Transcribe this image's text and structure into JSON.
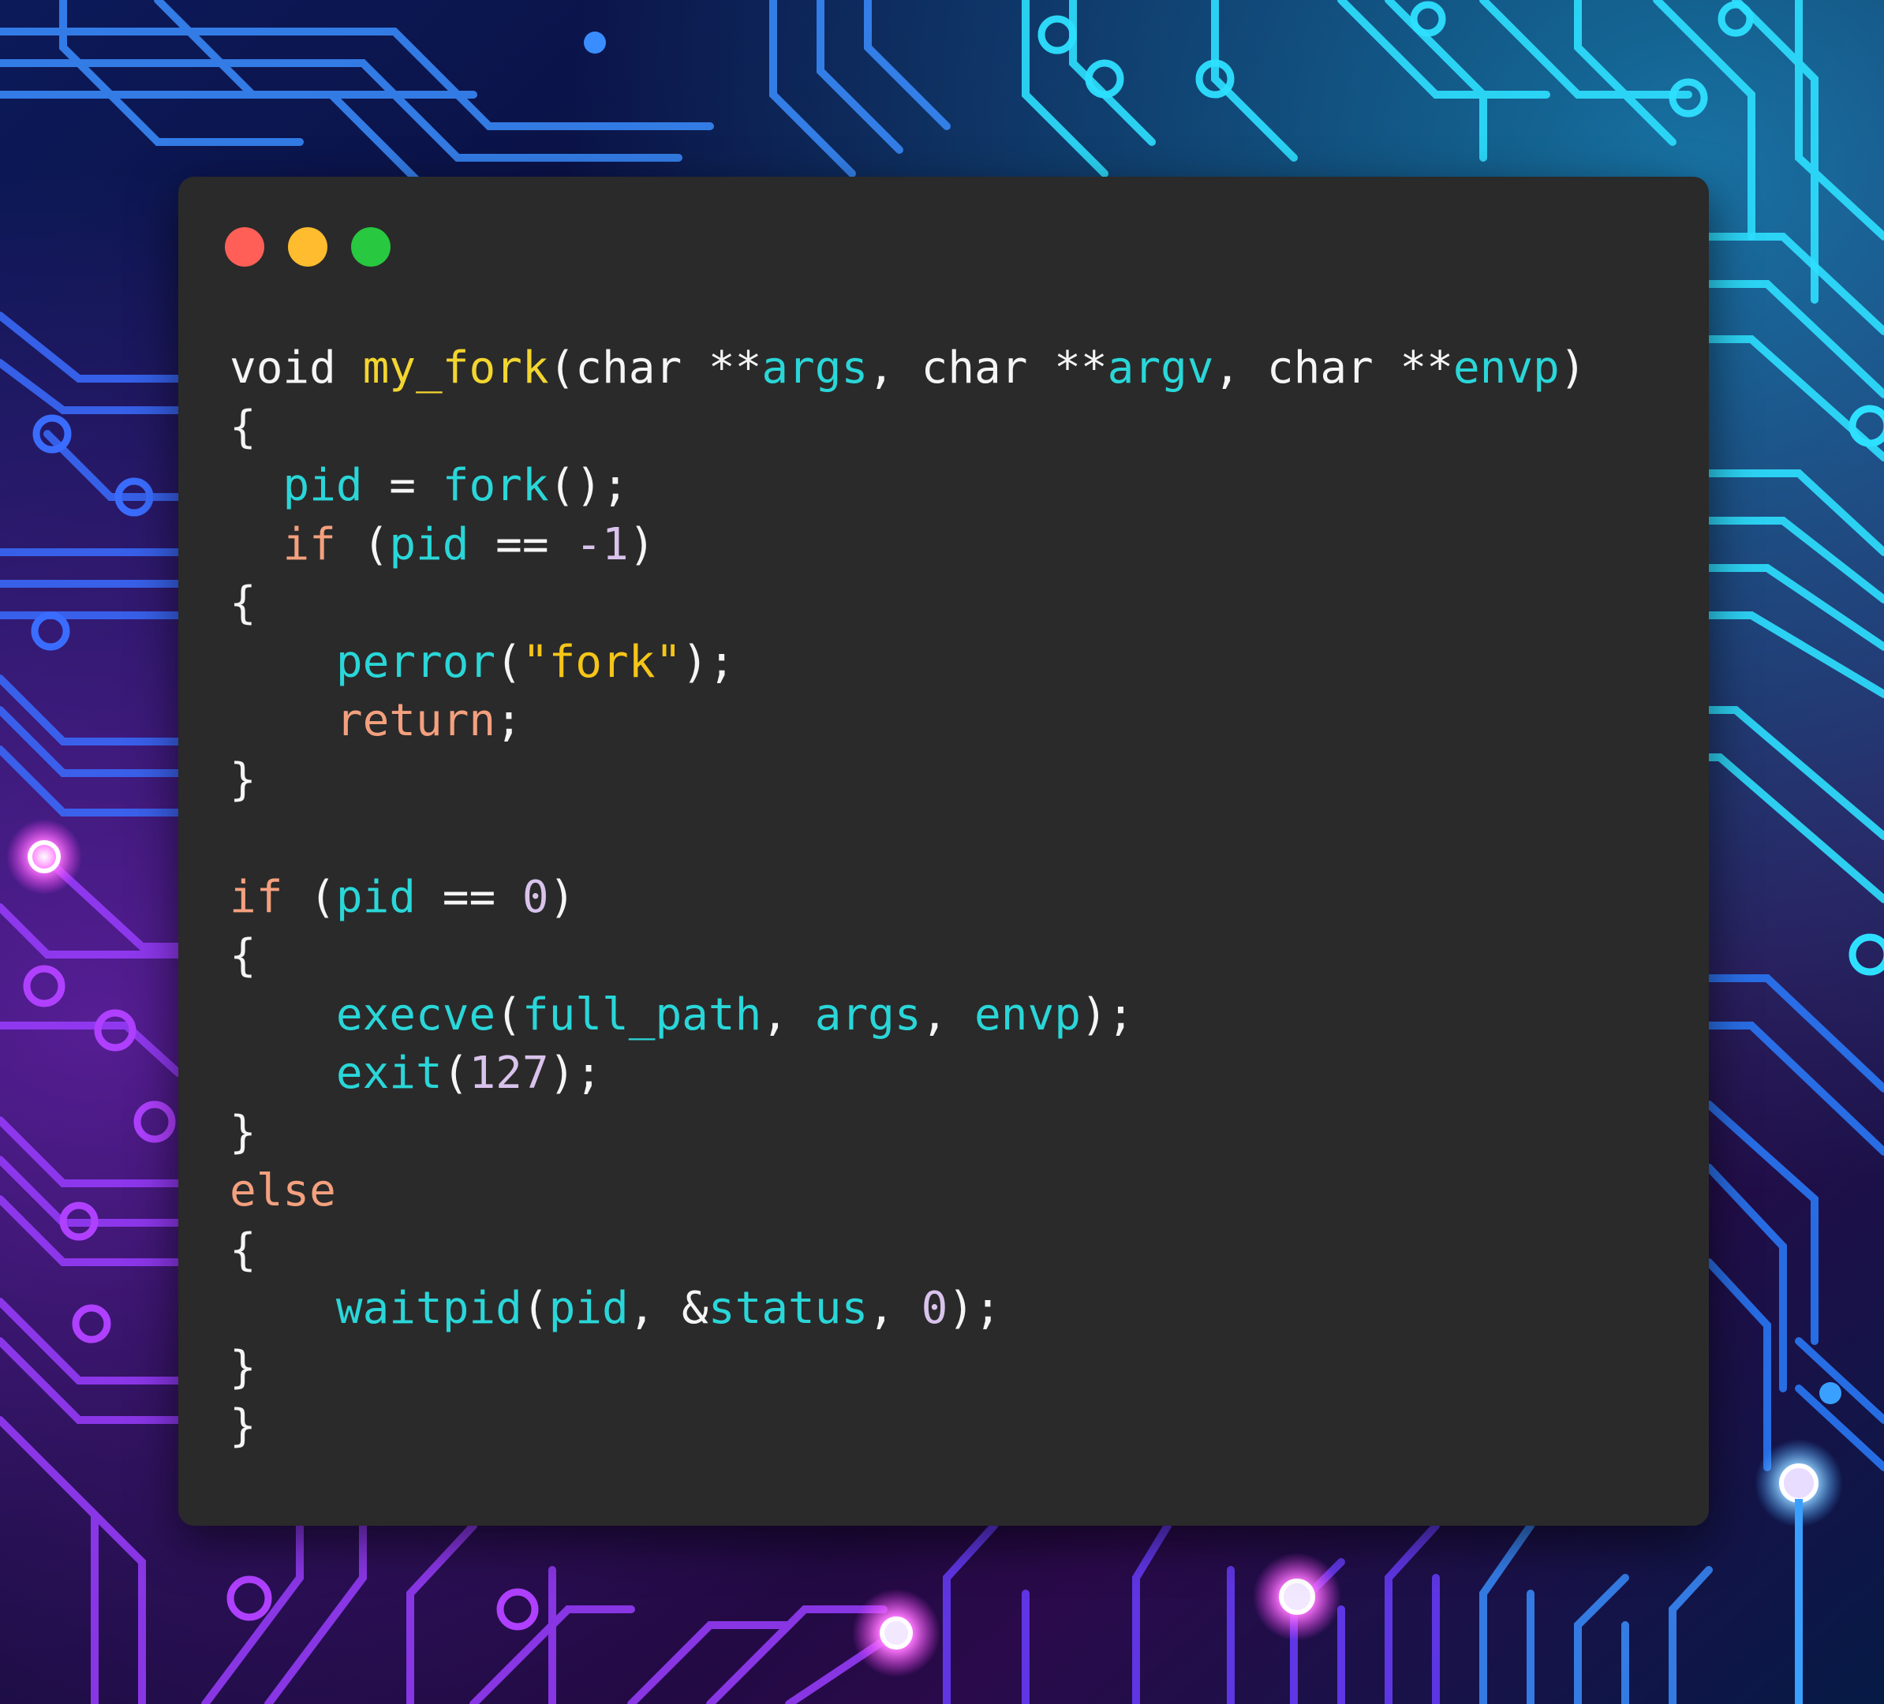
{
  "window": {
    "controls": [
      "close",
      "minimize",
      "zoom"
    ],
    "colors": {
      "close": "#ff5f57",
      "minimize": "#febc2e",
      "zoom": "#28c840",
      "background": "#2a2a2a"
    }
  },
  "theme": {
    "plain": "#f5f5f5",
    "func": "#f3d530",
    "ident": "#2ad6d8",
    "kw": "#f4a07e",
    "num": "#d9c3ec",
    "str": "#f5c518"
  },
  "code": {
    "language": "c",
    "lines": [
      [
        [
          "plain",
          "void "
        ],
        [
          "func",
          "my_fork"
        ],
        [
          "plain",
          "(char **"
        ],
        [
          "ident",
          "args"
        ],
        [
          "plain",
          ", char **"
        ],
        [
          "ident",
          "argv"
        ],
        [
          "plain",
          ", char **"
        ],
        [
          "ident",
          "envp"
        ],
        [
          "plain",
          ")"
        ]
      ],
      [
        [
          "plain",
          "{"
        ]
      ],
      [
        [
          "plain",
          "  "
        ],
        [
          "ident",
          "pid"
        ],
        [
          "plain",
          " = "
        ],
        [
          "ident",
          "fork"
        ],
        [
          "plain",
          "();"
        ]
      ],
      [
        [
          "plain",
          "  "
        ],
        [
          "kw",
          "if"
        ],
        [
          "plain",
          " ("
        ],
        [
          "ident",
          "pid"
        ],
        [
          "plain",
          " == "
        ],
        [
          "num",
          "-1"
        ],
        [
          "plain",
          ")"
        ]
      ],
      [
        [
          "plain",
          "{"
        ]
      ],
      [
        [
          "plain",
          "    "
        ],
        [
          "ident",
          "perror"
        ],
        [
          "plain",
          "("
        ],
        [
          "str",
          "\"fork\""
        ],
        [
          "plain",
          ");"
        ]
      ],
      [
        [
          "plain",
          "    "
        ],
        [
          "kw",
          "return"
        ],
        [
          "plain",
          ";"
        ]
      ],
      [
        [
          "plain",
          "}"
        ]
      ],
      [],
      [
        [
          "kw",
          "if"
        ],
        [
          "plain",
          " ("
        ],
        [
          "ident",
          "pid"
        ],
        [
          "plain",
          " == "
        ],
        [
          "num",
          "0"
        ],
        [
          "plain",
          ")"
        ]
      ],
      [
        [
          "plain",
          "{"
        ]
      ],
      [
        [
          "plain",
          "    "
        ],
        [
          "ident",
          "execve"
        ],
        [
          "plain",
          "("
        ],
        [
          "ident",
          "full_path"
        ],
        [
          "plain",
          ", "
        ],
        [
          "ident",
          "args"
        ],
        [
          "plain",
          ", "
        ],
        [
          "ident",
          "envp"
        ],
        [
          "plain",
          ");"
        ]
      ],
      [
        [
          "plain",
          "    "
        ],
        [
          "ident",
          "exit"
        ],
        [
          "plain",
          "("
        ],
        [
          "num",
          "127"
        ],
        [
          "plain",
          ");"
        ]
      ],
      [
        [
          "plain",
          "}"
        ]
      ],
      [
        [
          "kw",
          "else"
        ]
      ],
      [
        [
          "plain",
          "{"
        ]
      ],
      [
        [
          "plain",
          "    "
        ],
        [
          "ident",
          "waitpid"
        ],
        [
          "plain",
          "("
        ],
        [
          "ident",
          "pid"
        ],
        [
          "plain",
          ", &"
        ],
        [
          "ident",
          "status"
        ],
        [
          "plain",
          ", "
        ],
        [
          "num",
          "0"
        ],
        [
          "plain",
          ");"
        ]
      ],
      [
        [
          "plain",
          "}"
        ]
      ],
      [
        [
          "plain",
          "}"
        ]
      ]
    ]
  }
}
